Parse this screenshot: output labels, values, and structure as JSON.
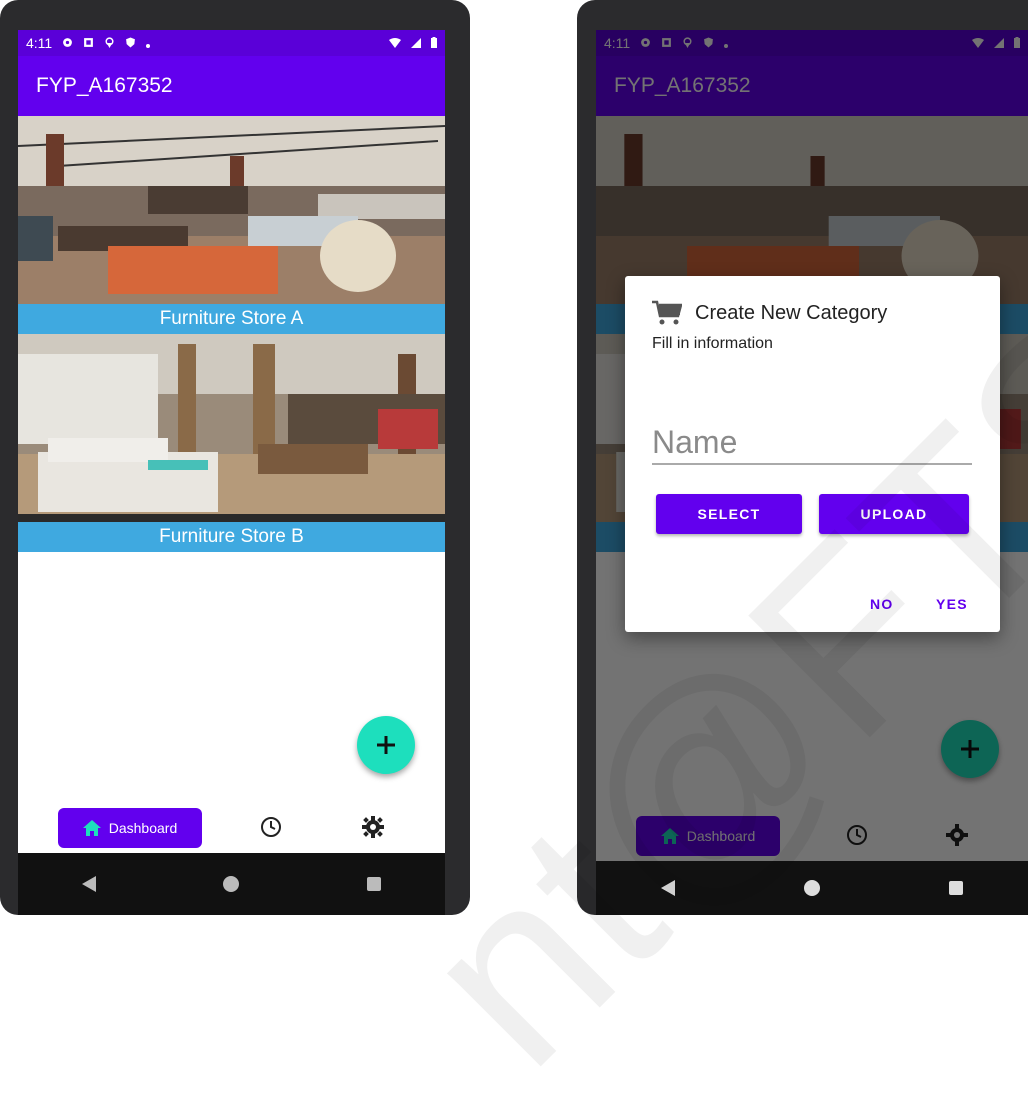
{
  "status_bar": {
    "time": "4:11"
  },
  "app_bar": {
    "title": "FYP_A167352"
  },
  "stores": [
    {
      "label": "Furniture Store A"
    },
    {
      "label": "Furniture Store B"
    }
  ],
  "fab": {
    "icon": "plus-icon",
    "label": "+"
  },
  "bottom_nav": {
    "dashboard_label": "Dashboard",
    "history_icon": "clock-icon",
    "settings_icon": "gear-icon"
  },
  "dialog": {
    "icon": "cart-icon",
    "title": "Create New Category",
    "subtitle": "Fill in information",
    "name_placeholder": "Name",
    "select_label": "SELECT",
    "upload_label": "UPLOAD",
    "no_label": "NO",
    "yes_label": "YES"
  },
  "watermark": "nt@FTSM",
  "colors": {
    "primary": "#6200ee",
    "status": "#5a00d8",
    "label_bg": "#3fa9e0",
    "fab": "#1ddfbd"
  }
}
